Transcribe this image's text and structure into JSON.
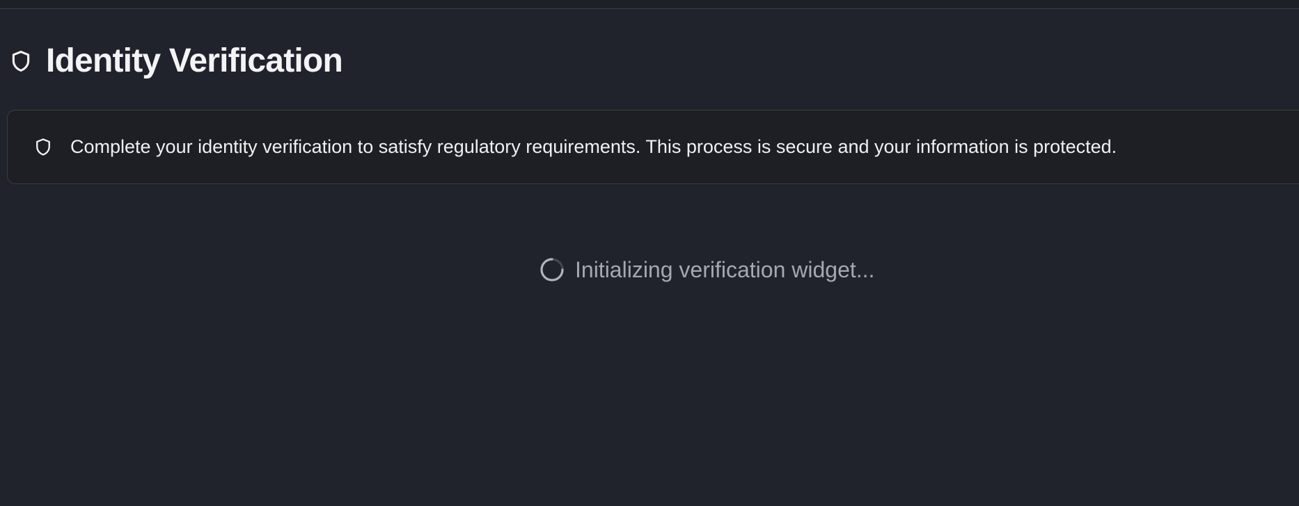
{
  "page": {
    "title": "Identity Verification",
    "title_icon": "shield-icon"
  },
  "notice": {
    "icon": "shield-icon",
    "text": "Complete your identity verification to satisfy regulatory requirements. This process is secure and your information is protected."
  },
  "loading": {
    "icon": "spinner-icon",
    "text": "Initializing verification widget..."
  },
  "colors": {
    "background": "#20232c",
    "card_background": "#1d1f25",
    "border": "#3a3d45",
    "text": "#f2f3f5",
    "muted_text": "#a4a8b1"
  }
}
